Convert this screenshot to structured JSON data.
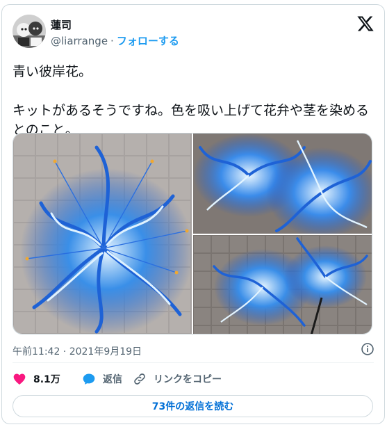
{
  "author": {
    "display_name": "蓮司",
    "handle": "@liarrange",
    "separator": "·",
    "follow_label": "フォローする"
  },
  "tweet": {
    "text": "青い彼岸花。\n\nキットがあるそうですね。色を吸い上げて花弁や茎を染めるとのこと。",
    "timestamp": "午前11:42 · 2021年9月19日"
  },
  "actions": {
    "like_count": "8.1万",
    "reply_label": "返信",
    "copy_link_label": "リンクをコピー"
  },
  "replies_button": {
    "label": "73件の返信を読む"
  },
  "colors": {
    "accent": "#1d9bf0",
    "like": "#f91880",
    "reply_link": "#006fd6",
    "muted": "#536471",
    "border": "#cfd9de"
  },
  "icons": {
    "brand": "x-logo-icon",
    "info": "info-icon",
    "like": "heart-icon",
    "reply": "speech-bubble-icon",
    "copy": "link-icon"
  }
}
